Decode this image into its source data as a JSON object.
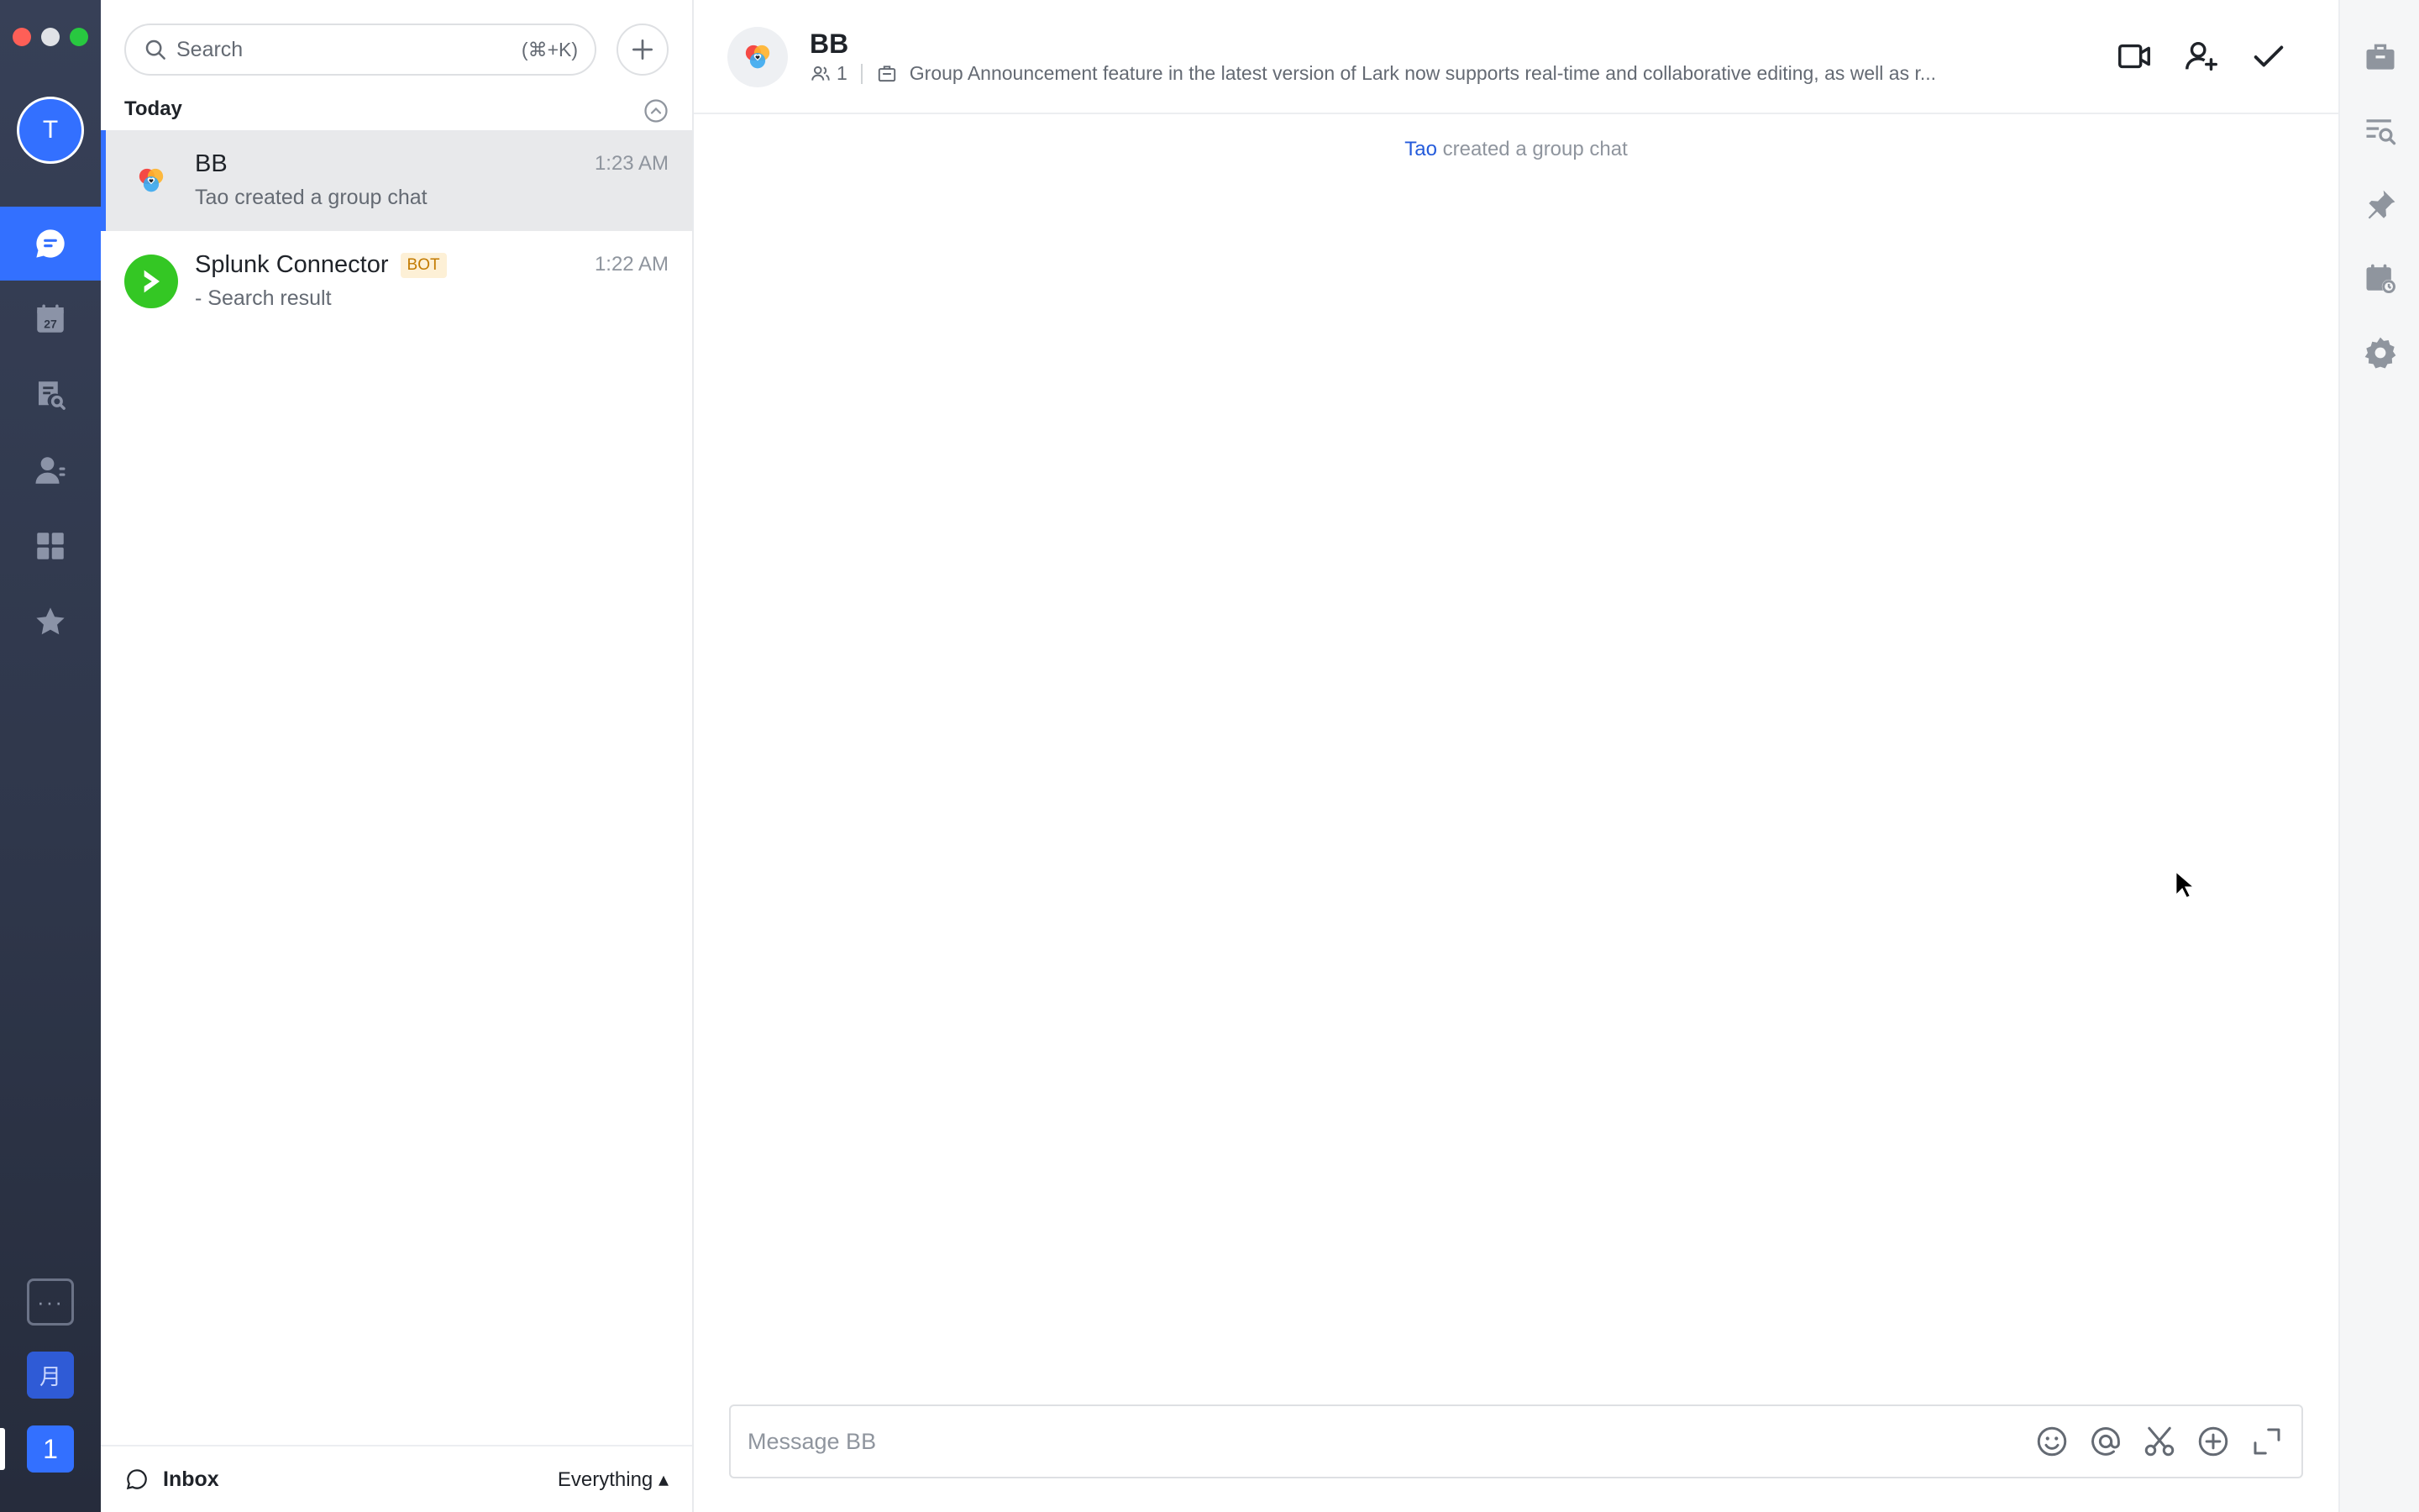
{
  "rail": {
    "avatar_letter": "T",
    "calendar_day": "27",
    "more_glyph": "···",
    "moon_app": "月",
    "one_app": "1",
    "accent": "#3370ff"
  },
  "list": {
    "search_placeholder": "Search",
    "search_shortcut": "(⌘+K)",
    "section": "Today",
    "chats": [
      {
        "name": "BB",
        "time": "1:23 AM",
        "preview": "Tao created a group chat",
        "selected": true
      },
      {
        "name": "Splunk Connector",
        "badge": "BOT",
        "time": "1:22 AM",
        "preview": "- Search result",
        "selected": false
      }
    ],
    "footer": {
      "inbox": "Inbox",
      "filter": "Everything ▴"
    }
  },
  "chat": {
    "title": "BB",
    "member_count": "1",
    "announcement": "Group Announcement feature in the latest version of Lark now supports real-time and collaborative editing, as well as r...",
    "system_message": {
      "who": "Tao",
      "text": " created a group chat"
    },
    "composer_placeholder": "Message BB"
  },
  "icons": {
    "rail": [
      "chat-icon",
      "calendar-icon",
      "docs-icon",
      "contacts-icon",
      "workplace-icon",
      "favorites-icon"
    ],
    "header": [
      "video-call-icon",
      "add-member-icon",
      "done-icon"
    ],
    "composer": [
      "emoji-icon",
      "mention-icon",
      "scissors-icon",
      "plus-circle-icon",
      "expand-icon"
    ],
    "side": [
      "briefcase-icon",
      "search-history-icon",
      "pin-icon",
      "calendar-event-icon",
      "settings-icon"
    ]
  }
}
